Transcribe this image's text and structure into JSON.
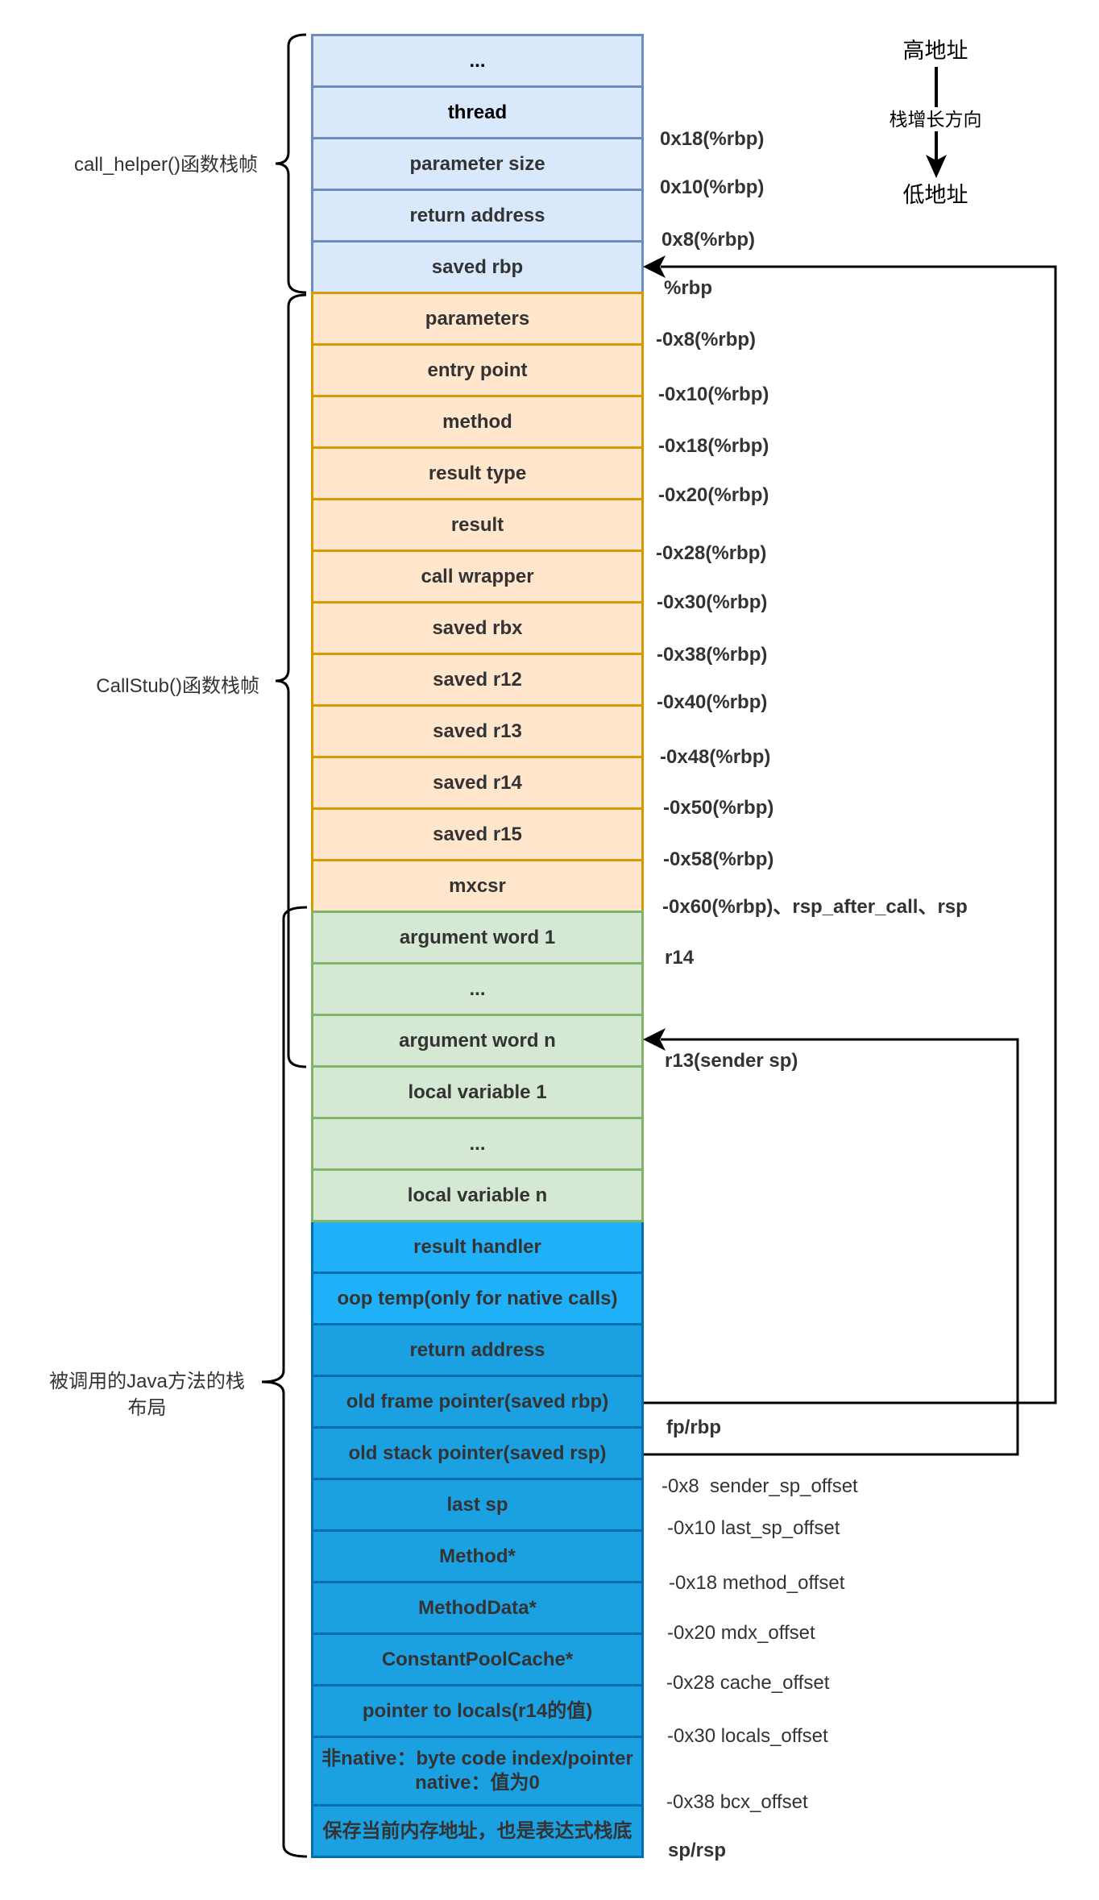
{
  "legend": {
    "high_address": "高地址",
    "growth_direction": "栈增长方向",
    "low_address": "低地址"
  },
  "frames": {
    "call_helper": {
      "label": "call_helper()函数栈帧"
    },
    "call_stub": {
      "label": "CallStub()函数栈帧"
    },
    "java_method": {
      "label_lines": [
        "被调用的Java方法的栈",
        "布局"
      ]
    }
  },
  "sections": {
    "call_helper": {
      "fill": "#dae8fc",
      "stroke": "#6c8ebf"
    },
    "call_stub": {
      "fill": "#ffe6cc",
      "stroke": "#d79b00"
    },
    "java_params_locals": {
      "fill": "#d5e8d4",
      "stroke": "#82b366"
    },
    "java_frame_bright": {
      "fill": "#1fb0f8",
      "stroke": "#006eaf"
    },
    "java_frame": {
      "fill": "#1ba1e2",
      "stroke": "#006eaf"
    }
  },
  "stack_rows": [
    {
      "label": "...",
      "section": "call_helper"
    },
    {
      "label": "thread",
      "section": "call_helper"
    },
    {
      "label": "parameter size",
      "section": "call_helper"
    },
    {
      "label": "return address",
      "section": "call_helper"
    },
    {
      "label": "saved rbp",
      "section": "call_helper"
    },
    {
      "label": "parameters",
      "section": "call_stub"
    },
    {
      "label": "entry point",
      "section": "call_stub"
    },
    {
      "label": "method",
      "section": "call_stub"
    },
    {
      "label": "result type",
      "section": "call_stub"
    },
    {
      "label": "result",
      "section": "call_stub"
    },
    {
      "label": "call wrapper",
      "section": "call_stub"
    },
    {
      "label": "saved rbx",
      "section": "call_stub"
    },
    {
      "label": "saved r12",
      "section": "call_stub"
    },
    {
      "label": "saved r13",
      "section": "call_stub"
    },
    {
      "label": "saved r14",
      "section": "call_stub"
    },
    {
      "label": "saved r15",
      "section": "call_stub"
    },
    {
      "label": "mxcsr",
      "section": "call_stub"
    },
    {
      "label": "argument word 1",
      "section": "java_params_locals"
    },
    {
      "label": "...",
      "section": "java_params_locals"
    },
    {
      "label": "argument word n",
      "section": "java_params_locals"
    },
    {
      "label": "local variable 1",
      "section": "java_params_locals"
    },
    {
      "label": "...",
      "section": "java_params_locals"
    },
    {
      "label": "local variable n",
      "section": "java_params_locals"
    },
    {
      "label": "result handler",
      "section": "java_frame_bright"
    },
    {
      "label": "oop temp(only for native calls)",
      "section": "java_frame_bright"
    },
    {
      "label": "return address",
      "section": "java_frame"
    },
    {
      "label": "old frame pointer(saved rbp)",
      "section": "java_frame"
    },
    {
      "label": "old stack pointer(saved rsp)",
      "section": "java_frame"
    },
    {
      "label": "last sp",
      "section": "java_frame"
    },
    {
      "label": "Method*",
      "section": "java_frame"
    },
    {
      "label": "MethodData*",
      "section": "java_frame"
    },
    {
      "label": "ConstantPoolCache*",
      "section": "java_frame"
    },
    {
      "label": "pointer to locals(r14的值)",
      "section": "java_frame"
    },
    {
      "lines": [
        "非native：byte code index/pointer",
        "native：值为0"
      ],
      "section": "java_frame"
    },
    {
      "label": "保存当前内存地址，也是表达式栈底",
      "section": "java_frame"
    }
  ],
  "offset_labels": [
    {
      "text": "0x18(%rbp)"
    },
    {
      "text": "0x10(%rbp)"
    },
    {
      "text": "0x8(%rbp)"
    },
    {
      "text": "%rbp"
    },
    {
      "text": "-0x8(%rbp)"
    },
    {
      "text": "-0x10(%rbp)"
    },
    {
      "text": "-0x18(%rbp)"
    },
    {
      "text": "-0x20(%rbp)"
    },
    {
      "text": "-0x28(%rbp)"
    },
    {
      "text": "-0x30(%rbp)"
    },
    {
      "text": "-0x38(%rbp)"
    },
    {
      "text": "-0x40(%rbp)"
    },
    {
      "text": "-0x48(%rbp)"
    },
    {
      "text": "-0x50(%rbp)"
    },
    {
      "text": "-0x58(%rbp)"
    },
    {
      "text": "-0x60(%rbp)、rsp_after_call、rsp"
    },
    {
      "text": "r14"
    },
    {
      "text": "r13(sender sp)"
    },
    {
      "text": "fp/rbp"
    },
    {
      "text": "-0x8  sender_sp_offset"
    },
    {
      "text": "-0x10 last_sp_offset"
    },
    {
      "text": "-0x18 method_offset"
    },
    {
      "text": "-0x20 mdx_offset"
    },
    {
      "text": "-0x28 cache_offset"
    },
    {
      "text": "-0x30 locals_offset"
    },
    {
      "text": "-0x38 bcx_offset"
    },
    {
      "text": "sp/rsp"
    }
  ],
  "arrows": [
    {
      "from": "old frame pointer(saved rbp)",
      "to": "saved rbp"
    },
    {
      "from": "old stack pointer(saved rsp)",
      "to": "argument word n"
    }
  ]
}
